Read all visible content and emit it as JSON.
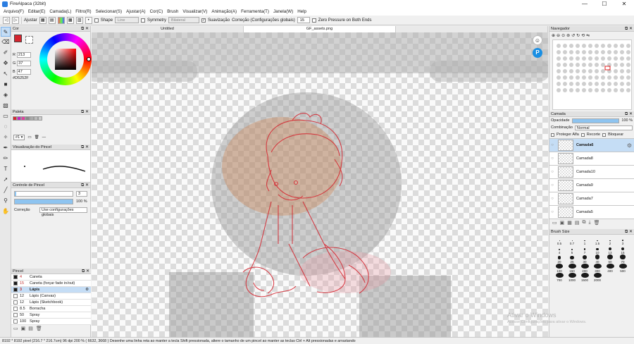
{
  "window": {
    "title": "FireAlpaca (32bit)",
    "minimize": "—",
    "maximize": "☐",
    "close": "✕"
  },
  "menu": [
    "Arquivo(F)",
    "Editar(E)",
    "Camada(L)",
    "Filtro(R)",
    "Selecionar(S)",
    "Ajustar(A)",
    "Cor(C)",
    "Brush",
    "Visualizar(V)",
    "Animação(A)",
    "Ferramenta(T)",
    "Janela(W)",
    "Help"
  ],
  "toolbar": {
    "adjust_label": "Ajustar",
    "shape_label": "Shape",
    "shape_value": "Line",
    "symmetry_label": "Symmetry",
    "symmetry_value": "Bilateral",
    "smoothing_label": "Suavização",
    "correction_label": "Correção (Configurações globais)",
    "correction_value": "15",
    "zero_pressure_label": "Zero Pressure on Both Ends"
  },
  "color_panel": {
    "title": "Cor",
    "r_label": "R",
    "r": "213",
    "g_label": "G",
    "g": "37",
    "b_label": "B",
    "b": "47",
    "hex": "#D5252F",
    "main_color": "#d5252f"
  },
  "palette_panel": {
    "title": "Paleta",
    "set": "#1 ▾",
    "colors": [
      "#d5252f",
      "#c424c4",
      "#e040a0",
      "#888888",
      "#aaaaaa",
      "#bbbbbb",
      "#cccccc"
    ]
  },
  "brush_view": {
    "title": "Visualização do Pincel"
  },
  "brush_control": {
    "title": "Controle de Pincel",
    "size": "3",
    "size_fraction": 0.97,
    "opacity": "100 %",
    "correction_label": "Correção",
    "correction_value": "Use configurações globais"
  },
  "pencil_panel": {
    "title": "Pincel",
    "items": [
      {
        "size": "4",
        "name": "Caneta",
        "color": "#1a1a1a"
      },
      {
        "size": "15",
        "name": "Caneta (forçar fade in/out)",
        "color": "#1a1a1a"
      },
      {
        "size": "3",
        "name": "Lápis",
        "color": "#1a1a1a"
      },
      {
        "size": "12",
        "name": "Lápis (Canvas)",
        "color": "#ffffff"
      },
      {
        "size": "12",
        "name": "Lápis (Sketchbook)",
        "color": "#ffffff"
      },
      {
        "size": "8.5",
        "name": "Borracha",
        "color": "#ffffff"
      },
      {
        "size": "50",
        "name": "Spray",
        "color": "#ffffff"
      },
      {
        "size": "100",
        "name": "Spray",
        "color": "#ffffff"
      }
    ],
    "active_index": 2
  },
  "doc_tabs": [
    {
      "label": "Untitled"
    },
    {
      "label": "GF_assets.png"
    },
    {
      "label": ""
    }
  ],
  "navigator": {
    "title": "Navegador"
  },
  "layer_panel": {
    "title": "Camada",
    "opacity_label": "Opacidade",
    "opacity": "100 %",
    "blend_label": "Combinação",
    "blend": "Normal",
    "protect_alpha": "Proteger Alfa",
    "clipping": "Recorte",
    "lock": "Bloquear",
    "layers": [
      "Camada6",
      "Camada8",
      "Camada10",
      "Camada9",
      "Camada7",
      "Camada5"
    ],
    "active_index": 0
  },
  "brush_size": {
    "title": "Brush Size",
    "sizes": [
      "0.5",
      "0.7",
      "1",
      "1.5",
      "2",
      "3",
      "4",
      "5",
      "7",
      "10",
      "13",
      "15",
      "20",
      "25",
      "30",
      "40",
      "50",
      "70",
      "100",
      "150",
      "200",
      "300",
      "400",
      "500",
      "700",
      "1000",
      "1500",
      "2000"
    ]
  },
  "watermark": {
    "line1": "Ativar o Windows",
    "line2": "Acesse Configurações para ativar o Windows."
  },
  "status": "8192 * 8192 pixel   (216.7 * 216.7cm)   96 dpi   200 %   ( 6632, 3668 )   Desenhe uma linha reta ao manter a tecla Shift pressionada, altere o tamanho de um pincel ao manter as teclas Ctrl + Alt pressionadas e arrastando"
}
